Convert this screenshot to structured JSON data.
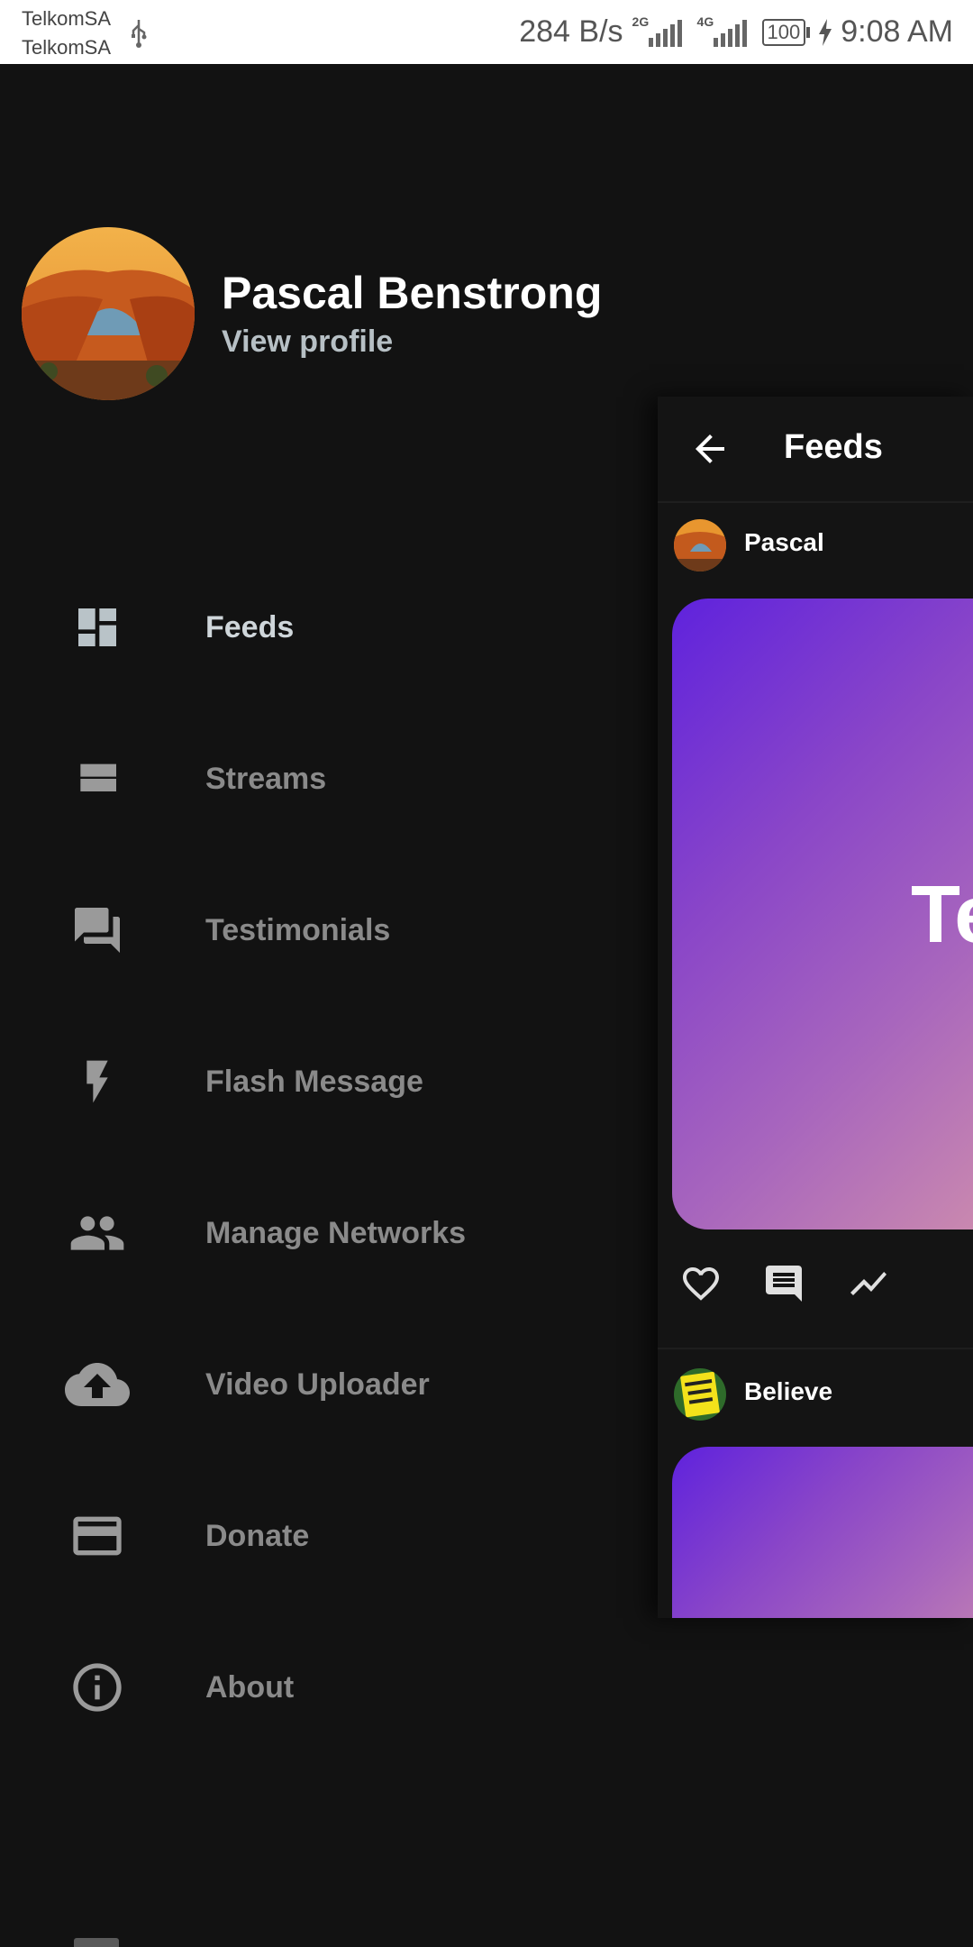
{
  "status_bar": {
    "carrier_1": "TelkomSA",
    "carrier_2": "TelkomSA",
    "speed": "284 B/s",
    "net_1": "2G",
    "net_2": "4G",
    "battery": "100",
    "time": "9:08 AM"
  },
  "profile": {
    "name": "Pascal Benstrong",
    "link": "View profile"
  },
  "menu": {
    "items": [
      {
        "label": "Feeds",
        "icon": "dashboard-icon",
        "active": true
      },
      {
        "label": "Streams",
        "icon": "view-stream-icon"
      },
      {
        "label": "Testimonials",
        "icon": "forum-icon"
      },
      {
        "label": "Flash Message",
        "icon": "flash-icon"
      },
      {
        "label": "Manage Networks",
        "icon": "people-icon"
      },
      {
        "label": "Video Uploader",
        "icon": "cloud-upload-icon"
      },
      {
        "label": "Donate",
        "icon": "credit-card-icon"
      },
      {
        "label": "About",
        "icon": "info-icon"
      }
    ]
  },
  "feeds_panel": {
    "title": "Feeds",
    "posts": [
      {
        "author": "Pascal",
        "card_text": "Te"
      },
      {
        "author": "Believe"
      }
    ]
  },
  "colors": {
    "background": "#121212",
    "active_label": "#cfd6da",
    "inactive_label": "#8a8a8a",
    "card_gradient_start": "#5f22dd",
    "card_gradient_end": "#d08fac"
  }
}
